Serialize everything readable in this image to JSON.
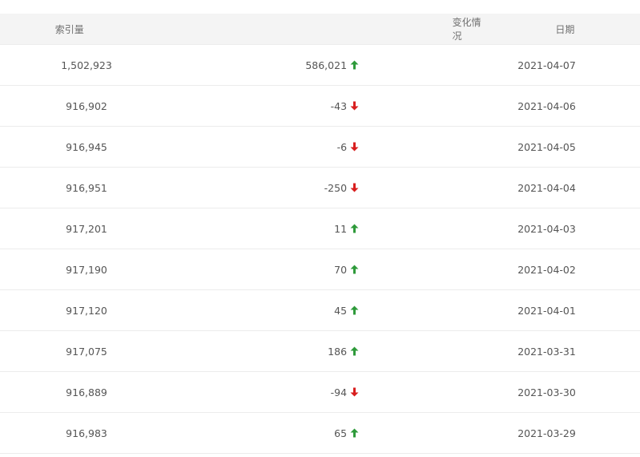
{
  "table": {
    "headers": {
      "index": "索引量",
      "change": "变化情况",
      "date": "日期"
    },
    "rows": [
      {
        "index": "1,502,923",
        "change": "586,021",
        "direction": "up",
        "date": "2021-04-07"
      },
      {
        "index": "916,902",
        "change": "-43",
        "direction": "down",
        "date": "2021-04-06"
      },
      {
        "index": "916,945",
        "change": "-6",
        "direction": "down",
        "date": "2021-04-05"
      },
      {
        "index": "916,951",
        "change": "-250",
        "direction": "down",
        "date": "2021-04-04"
      },
      {
        "index": "917,201",
        "change": "11",
        "direction": "up",
        "date": "2021-04-03"
      },
      {
        "index": "917,190",
        "change": "70",
        "direction": "up",
        "date": "2021-04-02"
      },
      {
        "index": "917,120",
        "change": "45",
        "direction": "up",
        "date": "2021-04-01"
      },
      {
        "index": "917,075",
        "change": "186",
        "direction": "up",
        "date": "2021-03-31"
      },
      {
        "index": "916,889",
        "change": "-94",
        "direction": "down",
        "date": "2021-03-30"
      },
      {
        "index": "916,983",
        "change": "65",
        "direction": "up",
        "date": "2021-03-29"
      }
    ]
  },
  "colors": {
    "up": "#2e9a3a",
    "down": "#d81e1e",
    "header_bg": "#f4f4f4",
    "text": "#555555"
  },
  "icons": {
    "up": "arrow-up-icon",
    "down": "arrow-down-icon"
  }
}
